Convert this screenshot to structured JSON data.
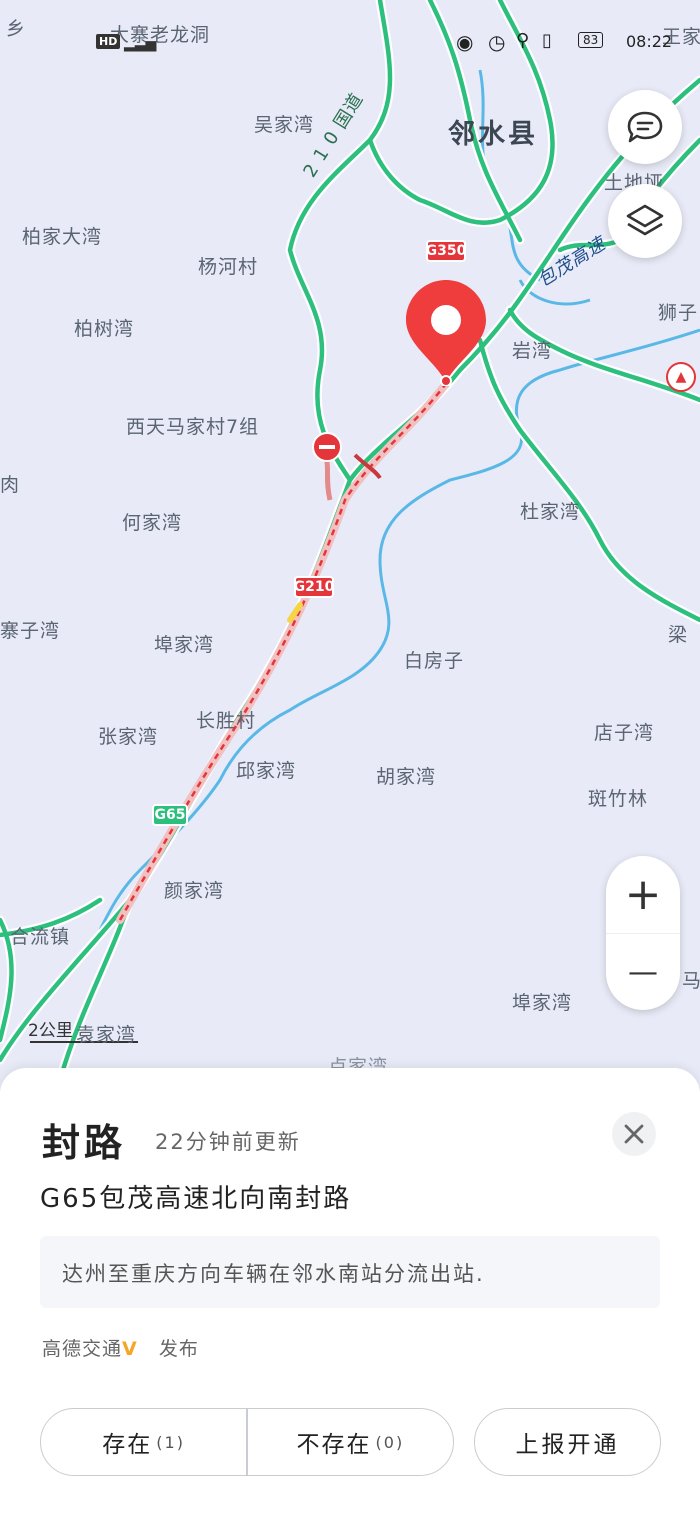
{
  "status_bar": {
    "network_label": "HD",
    "battery": "83",
    "time": "08:22"
  },
  "map": {
    "county_label": "邻水县",
    "places": [
      {
        "name": "乡"
      },
      {
        "name": "大寨老龙洞"
      },
      {
        "name": "王家"
      },
      {
        "name": "吴家湾"
      },
      {
        "name": "土地垭"
      },
      {
        "name": "柏家大湾"
      },
      {
        "name": "杨河村"
      },
      {
        "name": "柏树湾"
      },
      {
        "name": "狮子"
      },
      {
        "name": "岩湾"
      },
      {
        "name": "西天马家村7组"
      },
      {
        "name": "肉"
      },
      {
        "name": "杜家湾"
      },
      {
        "name": "何家湾"
      },
      {
        "name": "寨子湾"
      },
      {
        "name": "埠家湾"
      },
      {
        "name": "白房子"
      },
      {
        "name": "梁"
      },
      {
        "name": "长胜村"
      },
      {
        "name": "张家湾"
      },
      {
        "name": "店子湾"
      },
      {
        "name": "邱家湾"
      },
      {
        "name": "胡家湾"
      },
      {
        "name": "斑竹林"
      },
      {
        "name": "颜家湾"
      },
      {
        "name": "合流镇"
      },
      {
        "name": "马"
      },
      {
        "name": "埠家湾"
      },
      {
        "name": "袁家湾"
      },
      {
        "name": "卢家湾"
      }
    ],
    "road_labels": {
      "national_road": "2 1 0 国道",
      "expressway": "包茂高速"
    },
    "road_shields": {
      "g350": "G350",
      "g210": "G210",
      "g65": "G65"
    },
    "scale": "2公里"
  },
  "controls": {
    "feedback_icon": "message-icon",
    "layers_icon": "layers-icon",
    "zoom_in": "+",
    "zoom_out": "—"
  },
  "incident": {
    "title": "封路",
    "updated": "22分钟前更新",
    "subtitle": "G65包茂高速北向南封路",
    "description": "达州至重庆方向车辆在邻水南站分流出站.",
    "source": "高德交通",
    "publish_label": "发布",
    "buttons": {
      "exists": "存在",
      "exists_count": "(1)",
      "not_exists": "不存在",
      "not_exists_count": "(0)",
      "report_open": "上报开通"
    }
  },
  "colors": {
    "road_green": "#2dbf7e",
    "closure_red": "#e4353a",
    "river_blue": "#5ab8e6",
    "map_background": "#e8ebf7",
    "source_badge": "#f5a623"
  }
}
